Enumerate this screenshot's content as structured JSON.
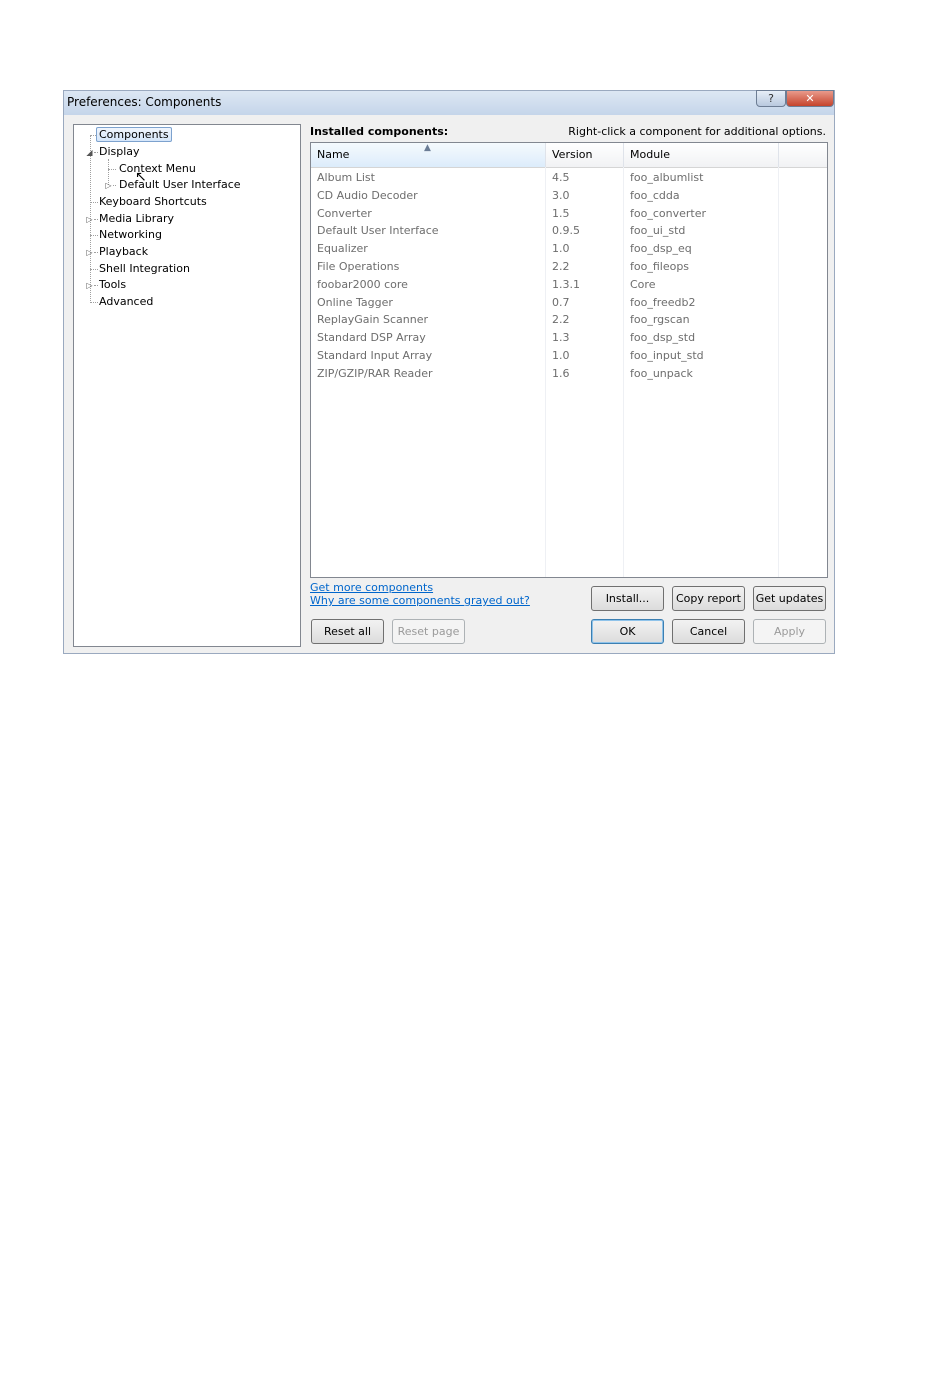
{
  "window": {
    "title": "Preferences: Components",
    "help_glyph": "?",
    "close_glyph": "✕"
  },
  "tree": {
    "items": [
      {
        "label": "Components",
        "selected": true
      },
      {
        "label": "Display",
        "expanded": true
      },
      {
        "label": "Context Menu"
      },
      {
        "label": "Default User Interface",
        "collapsed": true
      },
      {
        "label": "Keyboard Shortcuts"
      },
      {
        "label": "Media Library",
        "collapsed": true
      },
      {
        "label": "Networking"
      },
      {
        "label": "Playback",
        "collapsed": true
      },
      {
        "label": "Shell Integration"
      },
      {
        "label": "Tools",
        "collapsed": true
      },
      {
        "label": "Advanced"
      }
    ]
  },
  "panel": {
    "heading": "Installed components:",
    "hint": "Right-click a component for additional options."
  },
  "table": {
    "columns": [
      "Name",
      "Version",
      "Module"
    ],
    "rows": [
      [
        "Album List",
        "4.5",
        "foo_albumlist"
      ],
      [
        "CD Audio Decoder",
        "3.0",
        "foo_cdda"
      ],
      [
        "Converter",
        "1.5",
        "foo_converter"
      ],
      [
        "Default User Interface",
        "0.9.5",
        "foo_ui_std"
      ],
      [
        "Equalizer",
        "1.0",
        "foo_dsp_eq"
      ],
      [
        "File Operations",
        "2.2",
        "foo_fileops"
      ],
      [
        "foobar2000 core",
        "1.3.1",
        "Core"
      ],
      [
        "Online Tagger",
        "0.7",
        "foo_freedb2"
      ],
      [
        "ReplayGain Scanner",
        "2.2",
        "foo_rgscan"
      ],
      [
        "Standard DSP Array",
        "1.3",
        "foo_dsp_std"
      ],
      [
        "Standard Input Array",
        "1.0",
        "foo_input_std"
      ],
      [
        "ZIP/GZIP/RAR Reader",
        "1.6",
        "foo_unpack"
      ]
    ]
  },
  "links": {
    "get_more": "Get more components",
    "why_grayed": "Why are some components grayed out?"
  },
  "buttons": {
    "install": "Install...",
    "copy_report": "Copy report",
    "get_updates": "Get updates",
    "reset_all": "Reset all",
    "reset_page": "Reset page",
    "ok": "OK",
    "cancel": "Cancel",
    "apply": "Apply"
  },
  "icons": {
    "sort": "▲",
    "expand_collapsed": "▷",
    "expand_open": "◢",
    "cursor": "↖"
  }
}
